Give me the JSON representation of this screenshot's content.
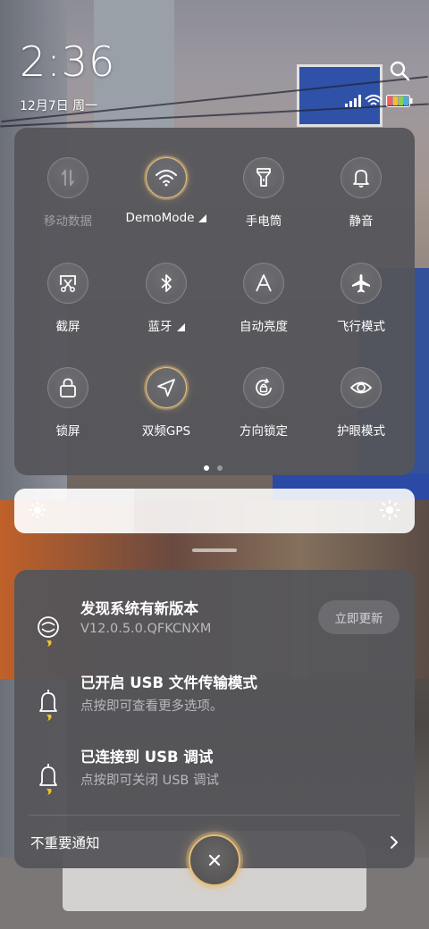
{
  "status": {
    "time": "2:36",
    "date": "12月7日 周一",
    "battery_color": "#f0c030"
  },
  "quick_settings": {
    "tiles": [
      {
        "label": "移动数据",
        "icon": "mobile-data-icon",
        "state": "disabled"
      },
      {
        "label": "DemoMode",
        "icon": "wifi-icon",
        "state": "on",
        "has_menu": true
      },
      {
        "label": "手电筒",
        "icon": "flashlight-icon",
        "state": "off"
      },
      {
        "label": "静音",
        "icon": "bell-icon",
        "state": "off"
      },
      {
        "label": "截屏",
        "icon": "screenshot-icon",
        "state": "off"
      },
      {
        "label": "蓝牙",
        "icon": "bluetooth-icon",
        "state": "off",
        "has_menu": true
      },
      {
        "label": "自动亮度",
        "icon": "auto-brightness-icon",
        "state": "off"
      },
      {
        "label": "飞行模式",
        "icon": "airplane-icon",
        "state": "off"
      },
      {
        "label": "锁屏",
        "icon": "lock-icon",
        "state": "off"
      },
      {
        "label": "双频GPS",
        "icon": "gps-icon",
        "state": "on"
      },
      {
        "label": "方向锁定",
        "icon": "rotation-lock-icon",
        "state": "off"
      },
      {
        "label": "护眼模式",
        "icon": "eye-icon",
        "state": "off"
      }
    ],
    "page_count": 2,
    "active_page": 1
  },
  "brightness": {
    "level": 0.3
  },
  "notifications": [
    {
      "title": "发现系统有新版本",
      "subtitle": "V12.0.5.0.QFKCNXM",
      "action": "立即更新",
      "icon": "system-update-icon"
    },
    {
      "title": "已开启 USB 文件传输模式",
      "subtitle": "点按即可查看更多选项。",
      "icon": "notification-bell-icon"
    },
    {
      "title": "已连接到 USB 调试",
      "subtitle": "点按即可关闭 USB 调试",
      "icon": "notification-bell-icon"
    }
  ],
  "footer": {
    "unimportant_label": "不重要通知"
  },
  "accent_color": "#e4bd78"
}
